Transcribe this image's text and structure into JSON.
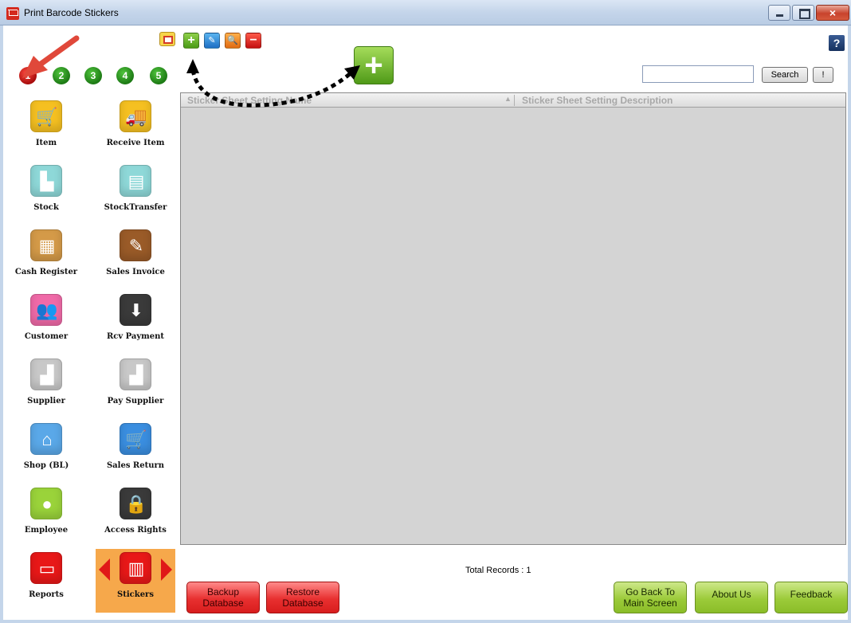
{
  "window": {
    "title": "Print Barcode Stickers",
    "close_glyph": "×"
  },
  "sidebar": {
    "pages": [
      "1",
      "2",
      "3",
      "4",
      "5"
    ],
    "items": [
      {
        "label": "Item",
        "icon": "shopping-cart-icon",
        "color": "#f5c021",
        "glyph": "🛒"
      },
      {
        "label": "Receive Item",
        "icon": "truck-icon",
        "color": "#f5c021",
        "glyph": "🚚"
      },
      {
        "label": "Stock",
        "icon": "hand-truck-icon",
        "color": "#8ed8d8",
        "glyph": "▙"
      },
      {
        "label": "StockTransfer",
        "icon": "box-transfer-icon",
        "color": "#8ed8d8",
        "glyph": "▤"
      },
      {
        "label": "Cash Register",
        "icon": "cash-register-icon",
        "color": "#d49a48",
        "glyph": "▦"
      },
      {
        "label": "Sales Invoice",
        "icon": "invoice-icon",
        "color": "#9a5b28",
        "glyph": "✎"
      },
      {
        "label": "Customer",
        "icon": "customers-icon",
        "color": "#f06aa8",
        "glyph": "👥"
      },
      {
        "label": "Rcv Payment",
        "icon": "coins-icon",
        "color": "#3a3a3a",
        "glyph": "⬇"
      },
      {
        "label": "Supplier",
        "icon": "factory-icon",
        "color": "#c8c8c8",
        "glyph": "▟"
      },
      {
        "label": "Pay Supplier",
        "icon": "factory-arrow-icon",
        "color": "#c8c8c8",
        "glyph": "▟"
      },
      {
        "label": "Shop (BL)",
        "icon": "shop-icon",
        "color": "#5aa8e8",
        "glyph": "⌂"
      },
      {
        "label": "Sales Return",
        "icon": "cart-return-icon",
        "color": "#3a8ee0",
        "glyph": "🛒"
      },
      {
        "label": "Employee",
        "icon": "employee-icon",
        "color": "#9ad33a",
        "glyph": "●"
      },
      {
        "label": "Access Rights",
        "icon": "lock-key-icon",
        "color": "#3a3a3a",
        "glyph": "🔒"
      },
      {
        "label": "Reports",
        "icon": "scroll-icon",
        "color": "#e81818",
        "glyph": "▭"
      },
      {
        "label": "Stickers",
        "icon": "barcode-sticker-icon",
        "color": "#e81818",
        "glyph": "▥"
      }
    ]
  },
  "toolbar": {
    "add_glyph": "+",
    "edit_glyph": "✎",
    "find_glyph": "🔍",
    "delete_glyph": "−",
    "big_add_glyph": "+",
    "help_glyph": "?"
  },
  "search": {
    "value": "",
    "button_label": "Search",
    "bang_label": "!"
  },
  "grid": {
    "columns": [
      "Sticker Sheet Setting Name",
      "Sticker Sheet Setting Description"
    ],
    "sort_glyph": "▲"
  },
  "status": {
    "total_records": "Total Records : 1"
  },
  "footer": {
    "backup": "Backup\nDatabase",
    "restore": "Restore\nDatabase",
    "go_back": "Go Back To\nMain Screen",
    "about": "About Us",
    "feedback": "Feedback"
  }
}
